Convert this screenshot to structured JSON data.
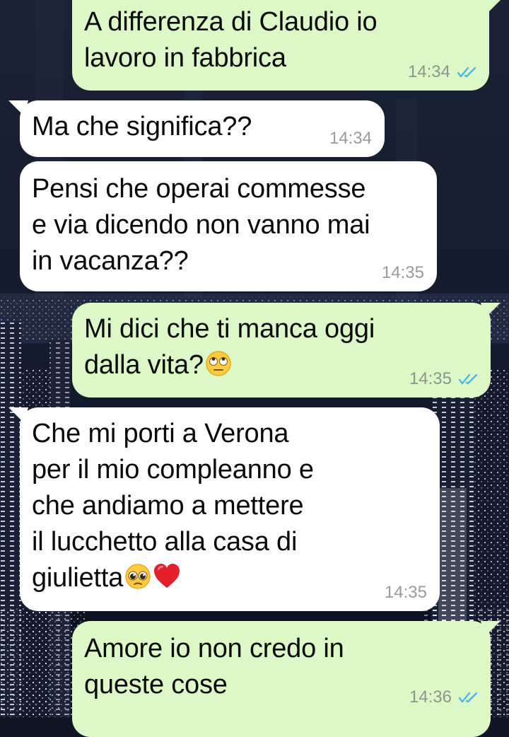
{
  "colors": {
    "outgoing_bubble": "#dcf8c6",
    "incoming_bubble": "#ffffff",
    "read_ticks": "#4fb6ec",
    "timestamp": "#8c968c",
    "background": "#101626"
  },
  "messages": [
    {
      "direction": "outgoing",
      "text": "A differenza di Claudio io\nlavoro in fabbrica",
      "time": "14:34",
      "status": "read"
    },
    {
      "direction": "incoming",
      "text": "Ma che significa??",
      "time": "14:34"
    },
    {
      "direction": "incoming",
      "text": "Pensi che operai commesse\ne via dicendo non vanno mai\nin vacanza??",
      "time": "14:35"
    },
    {
      "direction": "outgoing",
      "text": "Mi dici che ti manca oggi\ndalla vita?",
      "emoji": [
        "face-with-rolling-eyes-emoji"
      ],
      "time": "14:35",
      "status": "read"
    },
    {
      "direction": "incoming",
      "text": "Che mi porti a Verona\nper il mio compleanno e\nche andiamo a mettere\nil lucchetto alla casa di\ngiulietta",
      "emoji": [
        "pleading-face-emoji",
        "red-heart-emoji"
      ],
      "time": "14:35"
    },
    {
      "direction": "outgoing",
      "text": "Amore io non credo in\nqueste cose",
      "time": "14:36",
      "status": "read"
    }
  ]
}
